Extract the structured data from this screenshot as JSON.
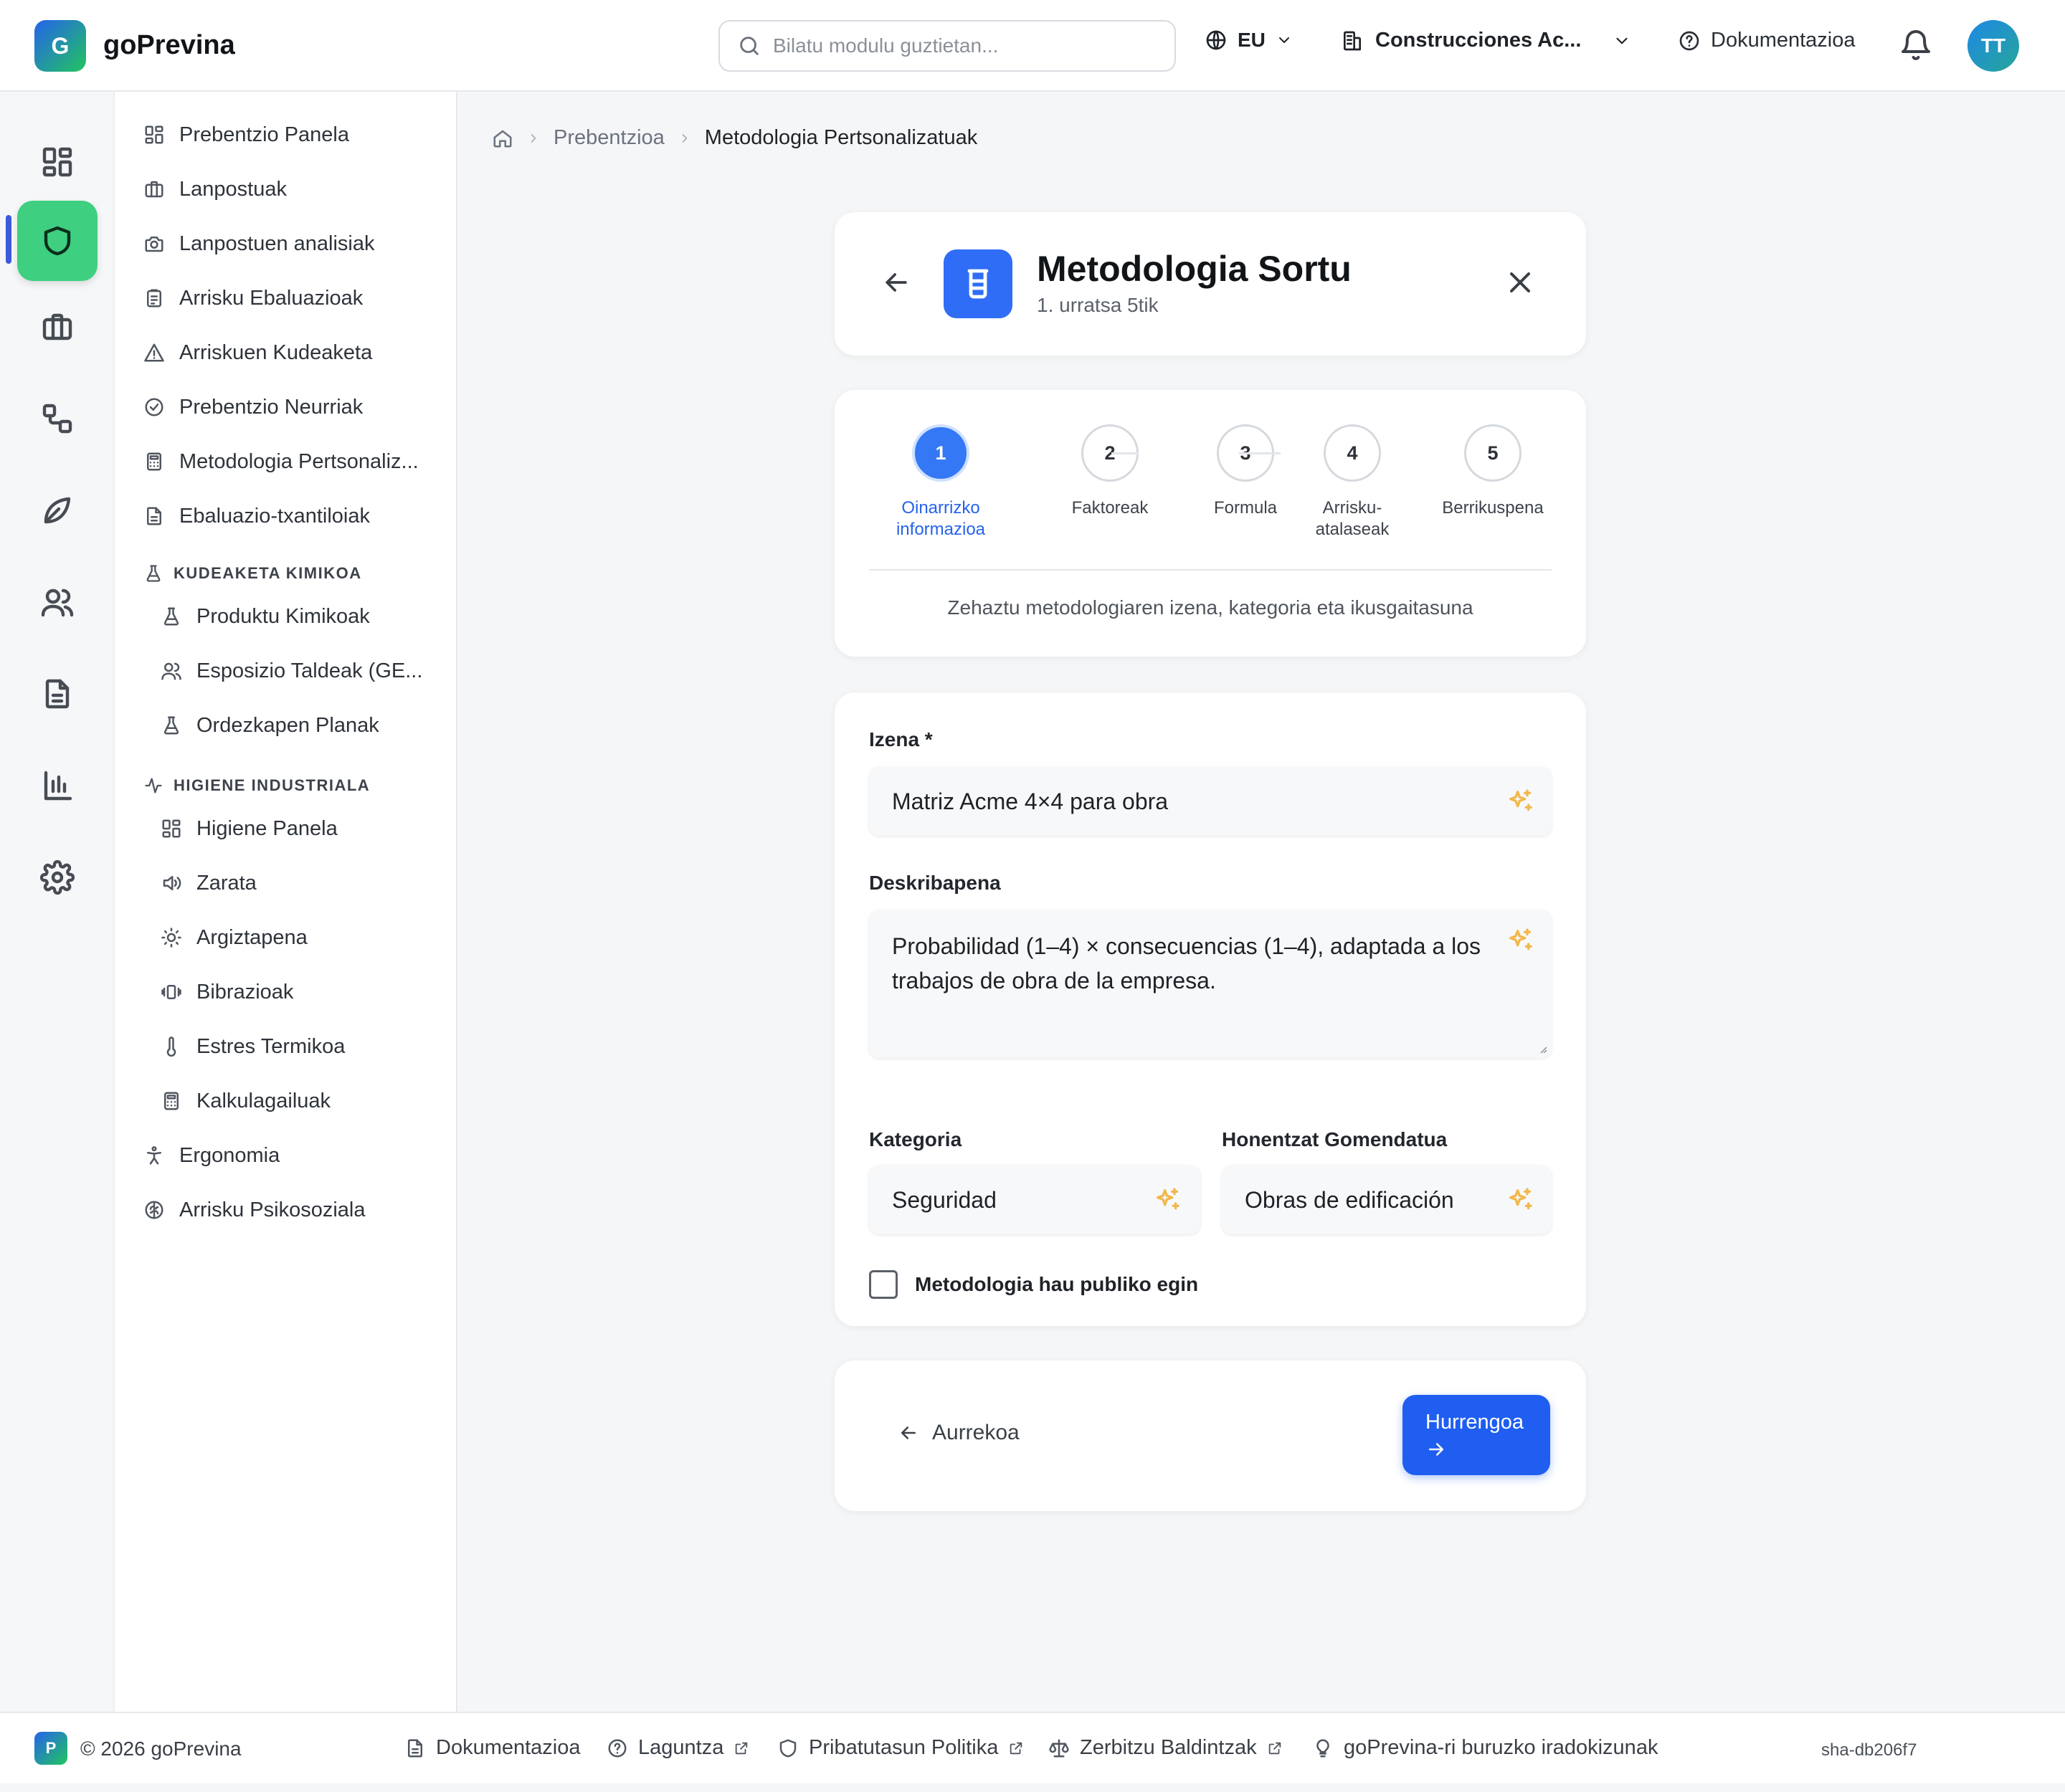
{
  "header": {
    "logo_letter": "G",
    "app_name": "goPrevina",
    "search_placeholder": "Bilatu modulu guztietan...",
    "language": "EU",
    "company": "Construcciones Ac...",
    "docs_label": "Dokumentazioa",
    "avatar_initials": "TT"
  },
  "rail": {
    "items": [
      "dashboard-icon",
      "shield-icon",
      "briefcase-icon",
      "workflow-icon",
      "leaf-icon",
      "users-icon",
      "document-icon",
      "bar-chart-icon",
      "gear-icon"
    ],
    "active": "shield-icon"
  },
  "sidebar": {
    "items": [
      {
        "label": "Prebentzio Panela",
        "icon": "grid-icon"
      },
      {
        "label": "Lanpostuak",
        "icon": "briefcase-icon"
      },
      {
        "label": "Lanpostuen analisiak",
        "icon": "camera-icon"
      },
      {
        "label": "Arrisku Ebaluazioak",
        "icon": "clipboard-icon"
      },
      {
        "label": "Arriskuen Kudeaketa",
        "icon": "warning-icon"
      },
      {
        "label": "Prebentzio Neurriak",
        "icon": "check-circle-icon"
      },
      {
        "label": "Metodologia Pertsonaliz...",
        "icon": "calculator-icon"
      },
      {
        "label": "Ebaluazio-txantiloiak",
        "icon": "file-text-icon"
      }
    ],
    "section_chemical": {
      "title": "KUDEAKETA KIMIKOA",
      "items": [
        {
          "label": "Produktu Kimikoak",
          "icon": "flask-icon"
        },
        {
          "label": "Esposizio Taldeak (GE...",
          "icon": "users-icon"
        },
        {
          "label": "Ordezkapen Planak",
          "icon": "flask-icon"
        }
      ]
    },
    "section_hygiene": {
      "title": "HIGIENE INDUSTRIALA",
      "items": [
        {
          "label": "Higiene Panela",
          "icon": "grid-icon"
        },
        {
          "label": "Zarata",
          "icon": "speaker-icon"
        },
        {
          "label": "Argiztapena",
          "icon": "sun-icon"
        },
        {
          "label": "Bibrazioak",
          "icon": "vibration-icon"
        },
        {
          "label": "Estres Termikoa",
          "icon": "thermometer-icon"
        },
        {
          "label": "Kalkulagailuak",
          "icon": "calculator-icon"
        }
      ]
    },
    "bottom_items": [
      {
        "label": "Ergonomia",
        "icon": "person-icon"
      },
      {
        "label": "Arrisku Psikosoziala",
        "icon": "brain-icon"
      }
    ]
  },
  "breadcrumb": {
    "items": [
      "Prebentzioa",
      "Metodologia Pertsonalizatuak"
    ]
  },
  "wizard": {
    "title": "Metodologia Sortu",
    "subtitle": "1. urratsa 5tik",
    "steps": [
      {
        "number": "1",
        "label": "Oinarrizko informazioa",
        "active": true
      },
      {
        "number": "2",
        "label": "Faktoreak",
        "active": false
      },
      {
        "number": "3",
        "label": "Formula",
        "active": false
      },
      {
        "number": "4",
        "label": "Arrisku-atalaseak",
        "active": false
      },
      {
        "number": "5",
        "label": "Berrikuspena",
        "active": false
      }
    ],
    "step_hint": "Zehaztu metodologiaren izena, kategoria eta ikusgaitasuna"
  },
  "form": {
    "name_label": "Izena *",
    "name_value": "Matriz Acme 4×4 para obra",
    "description_label": "Deskribapena",
    "description_value": "Probabilidad (1–4) × consecuencias (1–4), adaptada a los trabajos de obra de la empresa.",
    "category_label": "Kategoria",
    "category_value": "Seguridad",
    "recommended_label": "Honentzat Gomendatua",
    "recommended_value": "Obras de edificación",
    "public_label": "Metodologia hau publiko egin",
    "public_checked": false
  },
  "nav": {
    "prev_label": "Aurrekoa",
    "next_label": "Hurrengoa"
  },
  "footer": {
    "badge_letter": "P",
    "copyright": "© 2026 goPrevina",
    "links": [
      {
        "label": "Dokumentazioa",
        "icon": "file-text-icon",
        "external": false
      },
      {
        "label": "Laguntza",
        "icon": "help-circle-icon",
        "external": true
      },
      {
        "label": "Pribatutasun Politika",
        "icon": "shield-icon",
        "external": true
      },
      {
        "label": "Zerbitzu Baldintzak",
        "icon": "scale-icon",
        "external": true
      },
      {
        "label": "goPrevina-ri buruzko iradokizunak",
        "icon": "lightbulb-icon",
        "external": false
      }
    ],
    "version": "sha-db206f7"
  },
  "colors": {
    "primary": "#1f5ef0",
    "active_step": "#3478f6",
    "rail_active": "#3ecf80",
    "sparkle": "#f2b84b"
  }
}
